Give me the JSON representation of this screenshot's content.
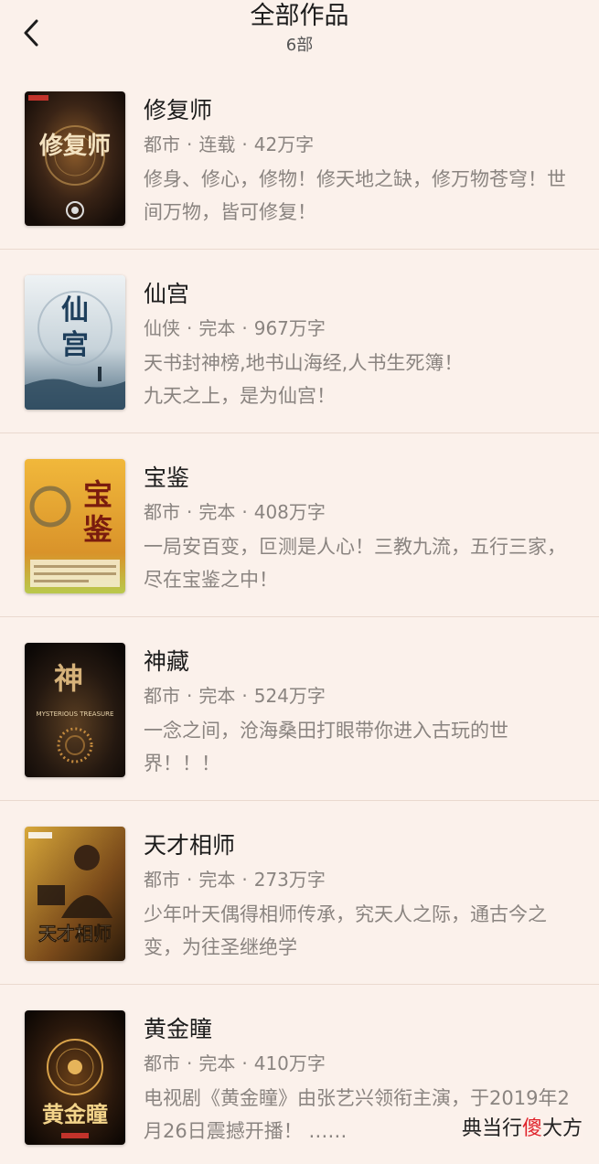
{
  "header": {
    "title": "全部作品",
    "subtitle": "6部"
  },
  "books": [
    {
      "title": "修复师",
      "genre": "都市",
      "status": "连载",
      "words": "42万字",
      "description": "修身、修心，修物！修天地之缺，修万物苍穹！世间万物，皆可修复！",
      "cover_text": "修复师"
    },
    {
      "title": "仙宫",
      "genre": "仙侠",
      "status": "完本",
      "words": "967万字",
      "description": "天书封神榜,地书山海经,人书生死簿！\n九天之上，是为仙宫！",
      "cover_text": "仙宫"
    },
    {
      "title": "宝鉴",
      "genre": "都市",
      "status": "完本",
      "words": "408万字",
      "description": "一局安百变，叵测是人心！三教九流，五行三家，尽在宝鉴之中！",
      "cover_text": "宝鉴"
    },
    {
      "title": "神藏",
      "genre": "都市",
      "status": "完本",
      "words": "524万字",
      "description": "一念之间，沧海桑田打眼带你进入古玩的世界！！！",
      "cover_text": "神",
      "cover_subtext": "MYSTERIOUS TREASURE"
    },
    {
      "title": "天才相师",
      "genre": "都市",
      "status": "完本",
      "words": "273万字",
      "description": "少年叶天偶得相师传承，究天人之际，通古今之变，为往圣继绝学",
      "cover_text": "天才相师"
    },
    {
      "title": "黄金瞳",
      "genre": "都市",
      "status": "完本",
      "words": "410万字",
      "description": "电视剧《黄金瞳》由张艺兴领衔主演，于2019年2月26日震撼开播！ ……",
      "cover_text": "黄金瞳"
    }
  ],
  "watermark": {
    "prefix": "典当行",
    "highlight": "傻",
    "suffix": "大方"
  },
  "colors": {
    "background": "#fbf1eb",
    "divider": "#ead9cf",
    "meta_text": "#8a8480",
    "title_text": "#1c1c1c"
  }
}
